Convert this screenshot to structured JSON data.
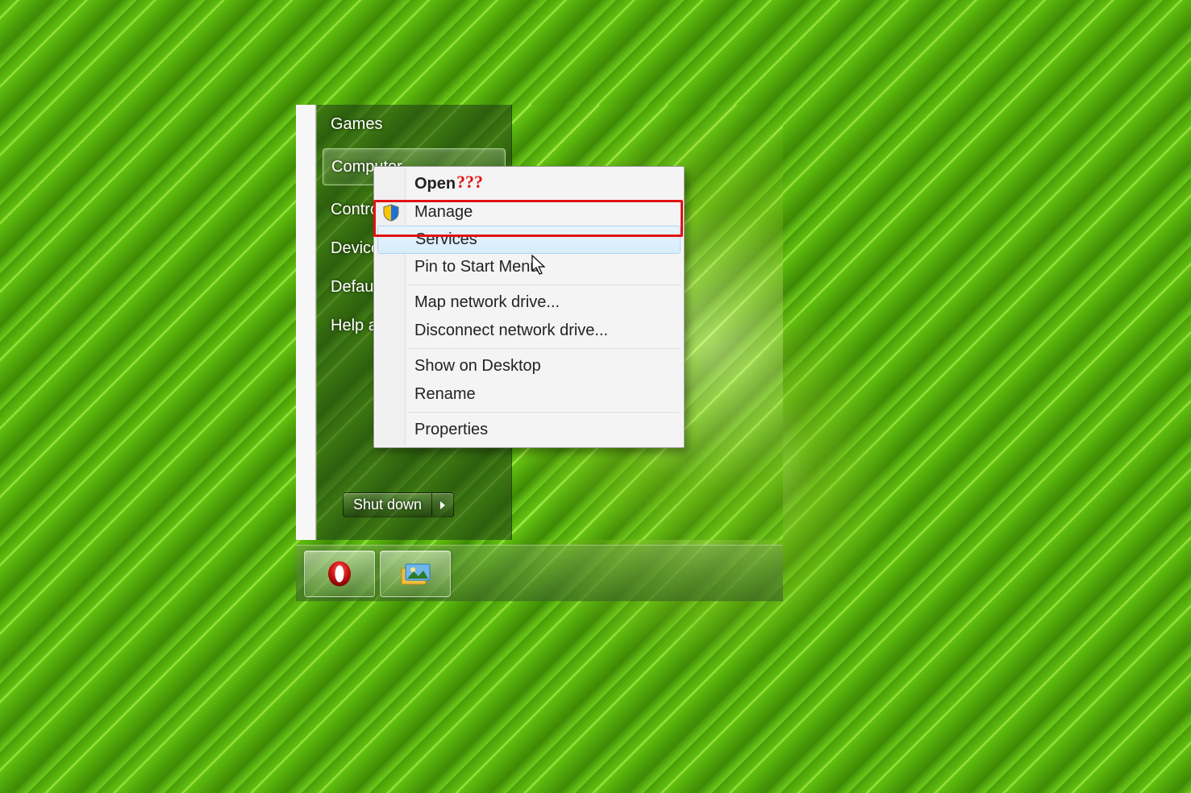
{
  "start_menu": {
    "items": [
      {
        "label": "Games"
      },
      {
        "label": "Computer",
        "selected": true
      },
      {
        "label": "Control Panel"
      },
      {
        "label": "Devices and Printers"
      },
      {
        "label": "Default Programs"
      },
      {
        "label": "Help and Support"
      }
    ],
    "shutdown_label": "Shut down"
  },
  "context_menu": {
    "items": [
      {
        "label": "Open",
        "bold": true,
        "annotation": "???"
      },
      {
        "label": "Manage",
        "icon": "uac-shield-icon",
        "highlighted": true
      },
      {
        "label": "Services",
        "hover": true
      },
      {
        "label": "Pin to Start Menu"
      },
      {
        "sep": true
      },
      {
        "label": "Map network drive..."
      },
      {
        "label": "Disconnect network drive..."
      },
      {
        "sep": true
      },
      {
        "label": "Show on Desktop"
      },
      {
        "label": "Rename"
      },
      {
        "sep": true
      },
      {
        "label": "Properties"
      }
    ]
  },
  "taskbar": {
    "items": [
      {
        "name": "opera-browser-icon"
      },
      {
        "name": "photo-viewer-icon"
      }
    ]
  },
  "overlay": {
    "annotation_text": "???",
    "annotation_color": "#e21212",
    "highlight_color": "#e21212"
  }
}
